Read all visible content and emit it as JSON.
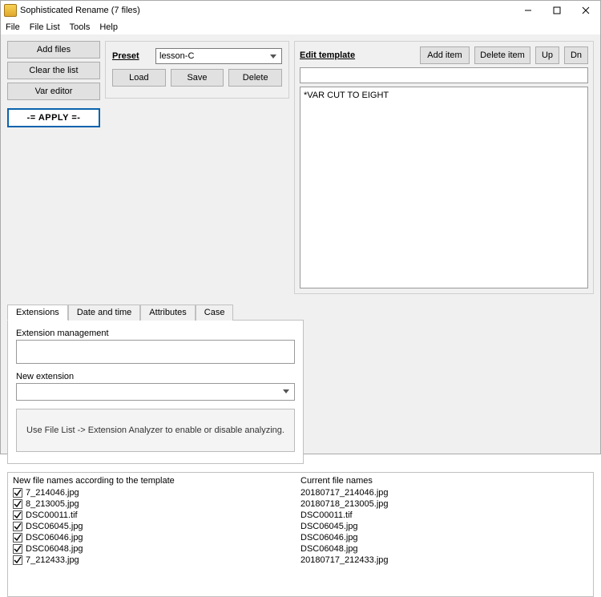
{
  "titlebar": {
    "title": "Sophisticated Rename (7 files)"
  },
  "menu": {
    "file": "File",
    "filelist": "File List",
    "tools": "Tools",
    "help": "Help"
  },
  "left_buttons": {
    "add": "Add files",
    "clear": "Clear the list",
    "var": "Var editor"
  },
  "preset": {
    "label": "Preset",
    "selected": "lesson-C",
    "load": "Load",
    "save": "Save",
    "delete": "Delete"
  },
  "apply": "-= APPLY =-",
  "edit": {
    "label": "Edit template",
    "add": "Add item",
    "delete": "Delete item",
    "up": "Up",
    "dn": "Dn",
    "field_value": "",
    "list_item0": "*VAR CUT TO EIGHT"
  },
  "tabs": {
    "ext": "Extensions",
    "dt": "Date and time",
    "attr": "Attributes",
    "case": "Case"
  },
  "ext_panel": {
    "groupA": "Extension management",
    "groupB": "New extension",
    "select_value": "",
    "hint": "Use File List -> Extension Analyzer to enable or disable analyzing."
  },
  "filebox": {
    "headerA": "New file names according to the template",
    "headerB": "Current file names",
    "rows": [
      {
        "new": "7_214046.jpg",
        "cur": "20180717_214046.jpg"
      },
      {
        "new": "8_213005.jpg",
        "cur": "20180718_213005.jpg"
      },
      {
        "new": "DSC00011.tif",
        "cur": "DSC00011.tif"
      },
      {
        "new": "DSC06045.jpg",
        "cur": "DSC06045.jpg"
      },
      {
        "new": "DSC06046.jpg",
        "cur": "DSC06046.jpg"
      },
      {
        "new": "DSC06048.jpg",
        "cur": "DSC06048.jpg"
      },
      {
        "new": "7_212433.jpg",
        "cur": "20180717_212433.jpg"
      }
    ]
  }
}
